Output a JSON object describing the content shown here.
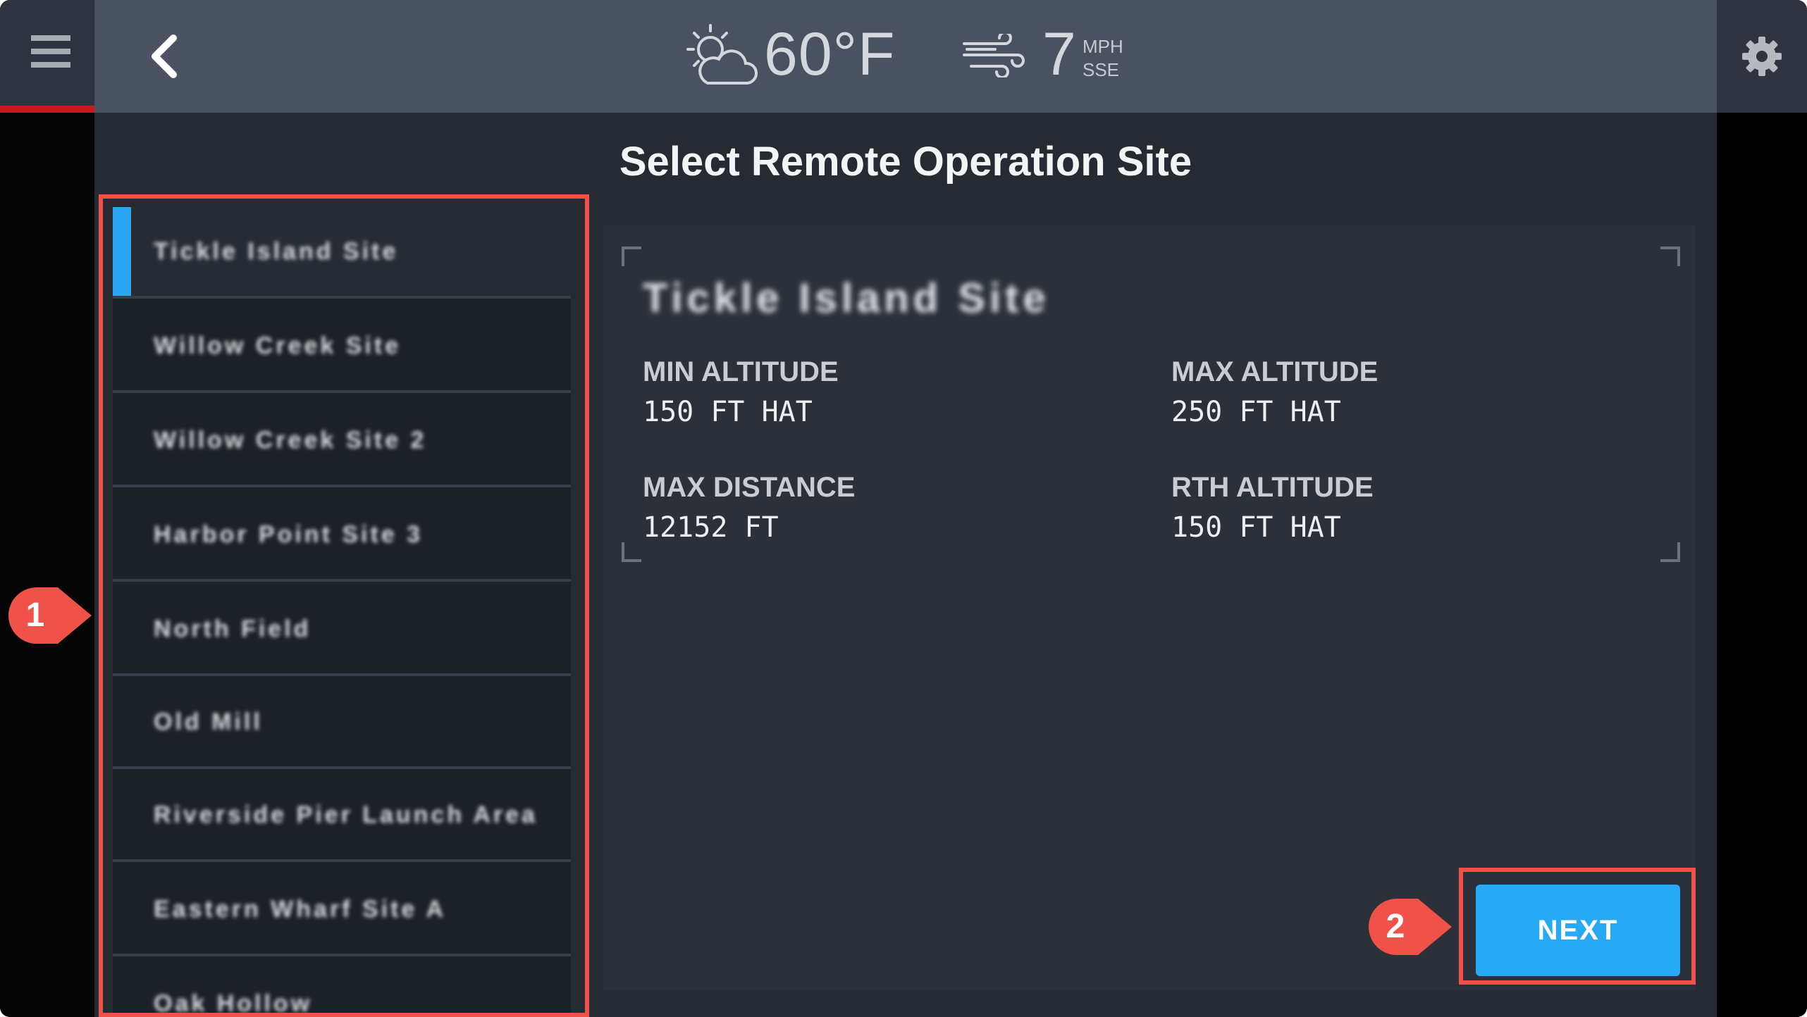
{
  "header": {
    "temperature": "60°F",
    "wind_speed": "7",
    "wind_unit": "MPH",
    "wind_direction": "SSE"
  },
  "page_title": "Select Remote Operation Site",
  "sites": [
    {
      "label": "Tickle Island Site",
      "selected": true
    },
    {
      "label": "Willow Creek Site",
      "selected": false
    },
    {
      "label": "Willow Creek Site 2",
      "selected": false
    },
    {
      "label": "Harbor Point Site 3",
      "selected": false
    },
    {
      "label": "North Field",
      "selected": false
    },
    {
      "label": "Old Mill",
      "selected": false
    },
    {
      "label": "Riverside Pier Launch Area",
      "selected": false
    },
    {
      "label": "Eastern Wharf Site A",
      "selected": false
    },
    {
      "label": "Oak Hollow",
      "selected": false
    }
  ],
  "detail": {
    "site_name": "Tickle Island Site",
    "min_altitude_label": "MIN ALTITUDE",
    "min_altitude_value": "150 FT HAT",
    "max_altitude_label": "MAX ALTITUDE",
    "max_altitude_value": "250 FT HAT",
    "max_distance_label": "MAX DISTANCE",
    "max_distance_value": "12152 FT",
    "rth_altitude_label": "RTH ALTITUDE",
    "rth_altitude_value": "150 FT HAT"
  },
  "next_label": "NEXT",
  "callouts": [
    "1",
    "2"
  ],
  "colors": {
    "accent": "#28a9f5",
    "highlight": "#f0524a",
    "alert_bar": "#c7191f"
  }
}
